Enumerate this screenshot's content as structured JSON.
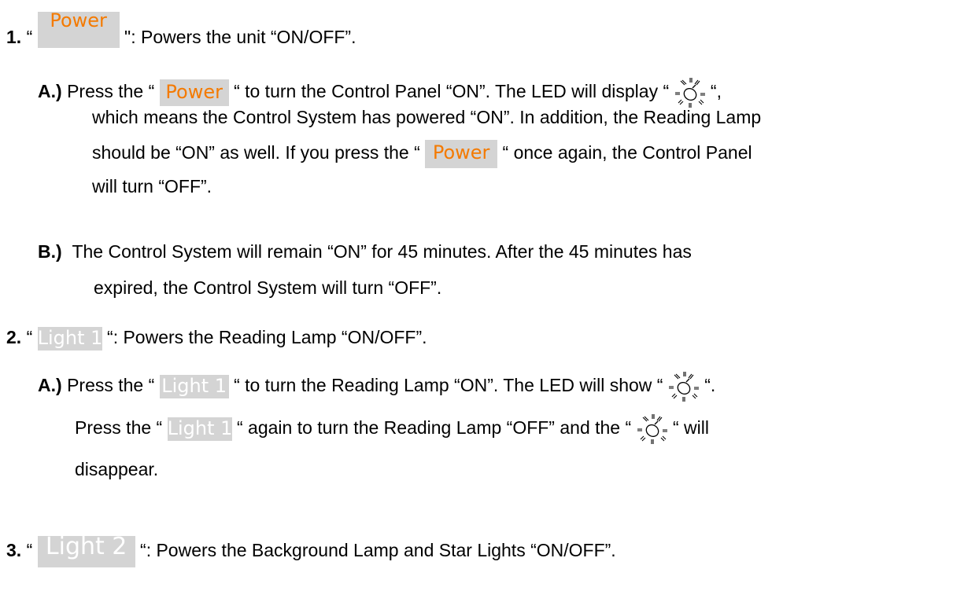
{
  "items": [
    {
      "number": "1.",
      "button_label": "Power",
      "description": "\": Powers the unit “ON/OFF”.",
      "subs": [
        {
          "letter": "A.)",
          "parts": [
            "Press the “",
            "“ to turn the Control Panel “ON”.  The LED will display “",
            "“,",
            "which means  the Control System has powered “ON”.  In addition, the Reading Lamp",
            "should be “ON” as well.  If you press the  “",
            "“ once again, the Control Panel",
            "will turn “OFF”."
          ]
        },
        {
          "letter": "B.)",
          "parts": [
            "The Control System will remain “ON” for 45 minutes.  After the 45 minutes has",
            "expired, the Control System will turn “OFF”."
          ]
        }
      ]
    },
    {
      "number": "2.",
      "button_label": "Light 1",
      "description": "“: Powers the Reading Lamp “ON/OFF”.",
      "subs": [
        {
          "letter": "A.)",
          "parts": [
            "Press the “",
            "“ to turn the Reading Lamp “ON”.  The LED will show “",
            "“.",
            "Press the “",
            "“ again to turn the Reading Lamp “OFF” and the “",
            "“ will",
            "disappear."
          ]
        }
      ]
    },
    {
      "number": "3.",
      "button_label": "Light 2",
      "description": "“: Powers the Background Lamp and Star Lights “ON/OFF”."
    }
  ],
  "open_quote": "“",
  "icons": {
    "led": "led-light-bulb-icon"
  },
  "colors": {
    "power_text": "#f47a00",
    "button_bg": "#d4d4d4",
    "light_text": "#ffffff"
  }
}
